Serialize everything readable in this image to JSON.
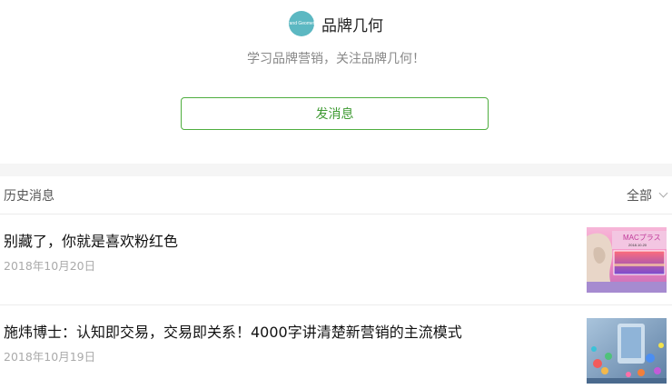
{
  "profile": {
    "avatar_text": "Brand Geometry",
    "name": "品牌几何",
    "slogan": "学习品牌营销，关注品牌几何！",
    "send_button": "发消息"
  },
  "history": {
    "title": "历史消息",
    "filter_label": "全部",
    "articles": [
      {
        "title": "别藏了，你就是喜欢粉红色",
        "date": "2018年10月20日",
        "thumb_text": "MACプラス",
        "thumb_sub": "2018.10.20"
      },
      {
        "title": "施炜博士：认知即交易，交易即关系！4000字讲清楚新营销的主流模式",
        "date": "2018年10月19日"
      }
    ]
  },
  "colors": {
    "accent": "#4fae3f",
    "avatar": "#5cb8c2"
  }
}
